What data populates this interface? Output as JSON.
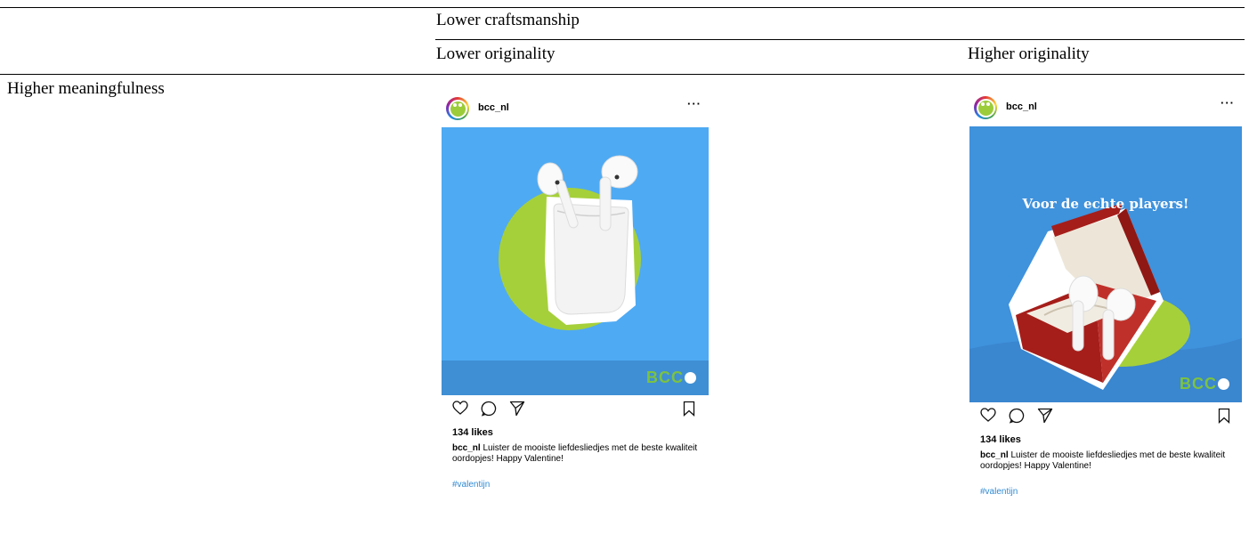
{
  "table": {
    "header_top": "Lower craftsmanship",
    "col_left": "Lower originality",
    "col_right": "Higher originality",
    "row_label": "Higher meaningfulness"
  },
  "posts": [
    {
      "username": "bcc_nl",
      "more": "···",
      "likes": "134 likes",
      "caption_user": "bcc_nl",
      "caption_text": " Luister de mooiste liefdesliedjes met de beste kwaliteit oordopjes! Happy Valentine!",
      "hashtag": "#valentijn",
      "brand_letters": "BCC",
      "colors": {
        "sky": "#4eaaf3",
        "band": "#3f8fd4",
        "circle": "#a6d03a"
      }
    },
    {
      "username": "bcc_nl",
      "more": "···",
      "headline": "Voor de echte players!",
      "likes": "134 likes",
      "caption_user": "bcc_nl",
      "caption_text": " Luister de mooiste liefdesliedjes met de beste kwaliteit oordopjes! Happy Valentine!",
      "hashtag": "#valentijn",
      "brand_letters": "BCC",
      "colors": {
        "sky": "#3f92dc",
        "band": "#3a86cf",
        "circle": "#a6d03a",
        "box": "#a51e1a"
      }
    }
  ]
}
